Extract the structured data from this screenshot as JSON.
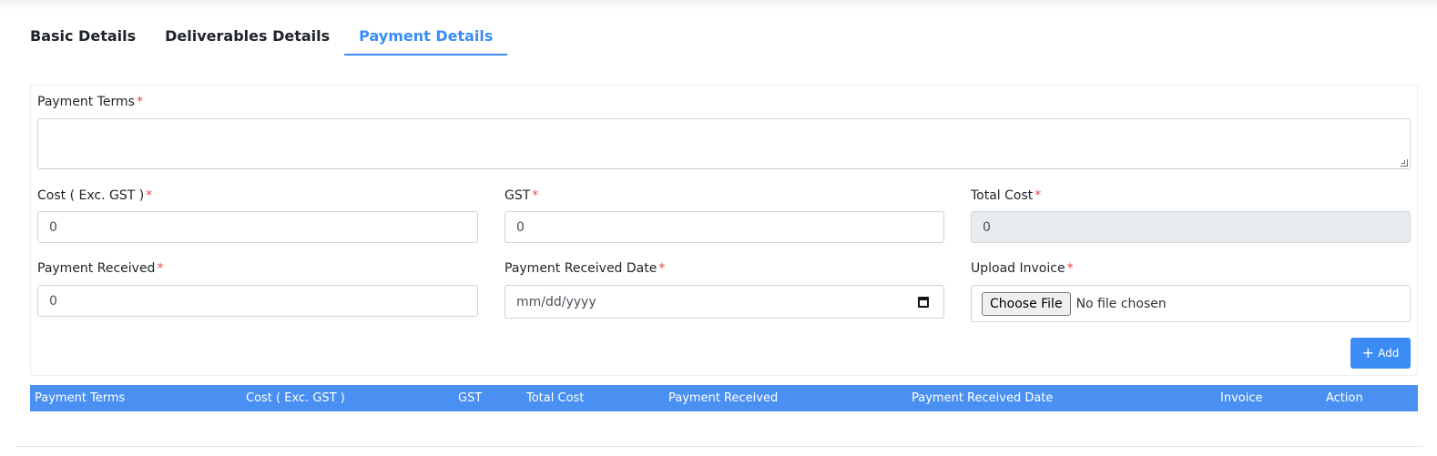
{
  "tabs": [
    "Basic Details",
    "Deliverables Details",
    "Payment Details"
  ],
  "form": {
    "payment_terms_label": "Payment Terms",
    "payment_terms_value": "",
    "cost_label": "Cost ( Exc. GST )",
    "cost_value": "0",
    "gst_label": "GST",
    "gst_value": "0",
    "total_cost_label": "Total Cost",
    "total_cost_value": "0",
    "payment_received_label": "Payment Received",
    "payment_received_value": "0",
    "payment_received_date_label": "Payment Received Date",
    "payment_received_date_placeholder": "mm/dd/yyyy",
    "upload_invoice_label": "Upload Invoice",
    "choose_file_label": "Choose File",
    "no_file_text": "No file chosen",
    "required_mark": "*"
  },
  "add_button_label": "Add",
  "table": {
    "headers": [
      "Payment Terms",
      "Cost ( Exc. GST )",
      "GST",
      "Total Cost",
      "Payment Received",
      "Payment Received Date",
      "Invoice",
      "Action"
    ]
  },
  "colors": {
    "accent": "#3b8df5",
    "table_header": "#4a90f3",
    "required": "#e5484d"
  },
  "icons": {
    "add": "plus-icon",
    "date": "calendar-icon",
    "textarea_resize": "resize-handle-icon"
  }
}
